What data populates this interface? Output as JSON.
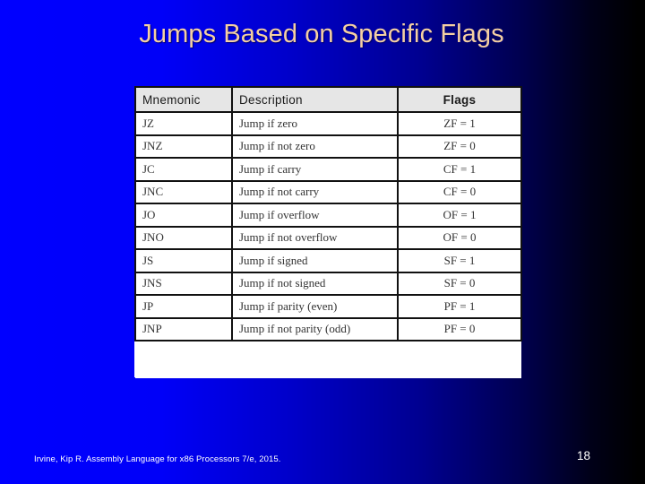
{
  "slide": {
    "title": "Jumps Based on Specific Flags",
    "citation": "Irvine, Kip R. Assembly Language for x86 Processors 7/e, 2015.",
    "page_number": "18",
    "colors": {
      "background_start": "#0000ff",
      "background_end": "#000000",
      "title": "#f4cfa2",
      "header_row": "#e6e6e6"
    }
  },
  "table": {
    "headers": [
      "Mnemonic",
      "Description",
      "Flags"
    ],
    "rows": [
      {
        "mnemonic": "JZ",
        "description": "Jump if zero",
        "flags": "ZF = 1"
      },
      {
        "mnemonic": "JNZ",
        "description": "Jump if not zero",
        "flags": "ZF = 0"
      },
      {
        "mnemonic": "JC",
        "description": "Jump if carry",
        "flags": "CF = 1"
      },
      {
        "mnemonic": "JNC",
        "description": "Jump if not carry",
        "flags": "CF = 0"
      },
      {
        "mnemonic": "JO",
        "description": "Jump if overflow",
        "flags": "OF = 1"
      },
      {
        "mnemonic": "JNO",
        "description": "Jump if not overflow",
        "flags": "OF = 0"
      },
      {
        "mnemonic": "JS",
        "description": "Jump if signed",
        "flags": "SF = 1"
      },
      {
        "mnemonic": "JNS",
        "description": "Jump if not signed",
        "flags": "SF = 0"
      },
      {
        "mnemonic": "JP",
        "description": "Jump if parity (even)",
        "flags": "PF = 1"
      },
      {
        "mnemonic": "JNP",
        "description": "Jump if not parity (odd)",
        "flags": "PF = 0"
      }
    ]
  }
}
